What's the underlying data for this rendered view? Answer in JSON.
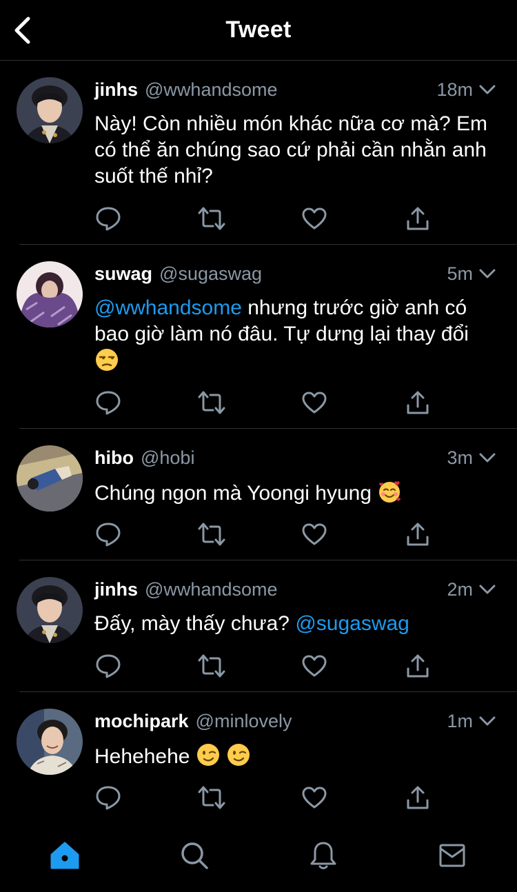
{
  "header": {
    "title": "Tweet"
  },
  "colors": {
    "background": "#000000",
    "text": "#ffffff",
    "muted": "#8b98a5",
    "accent": "#1d9bf0",
    "divider": "#2f3336"
  },
  "tweets": [
    {
      "name": "jinhs",
      "handle": "@wwhandsome",
      "time": "18m",
      "text": "Này! Còn nhiều món khác nữa cơ mà? Em có thể ăn chúng sao cứ phải cần nhằn anh suốt thế nhỉ?",
      "avatar": "avatar-jinhs"
    },
    {
      "name": "suwag",
      "handle": "@sugaswag",
      "time": "5m",
      "mention": "@wwhandsome",
      "text": " nhưng trước giờ anh có bao giờ làm nó đâu. Tự dưng lại thay đổi ",
      "emojis": [
        "unamused-face-emoji"
      ],
      "avatar": "avatar-suwag"
    },
    {
      "name": "hibo",
      "handle": "@hobi",
      "time": "3m",
      "text": "Chúng ngon mà Yoongi hyung ",
      "emojis": [
        "smiling-face-with-hearts-emoji"
      ],
      "avatar": "avatar-hibo"
    },
    {
      "name": "jinhs",
      "handle": "@wwhandsome",
      "time": "2m",
      "text": "Đấy, mày thấy chưa? ",
      "mention": "@sugaswag",
      "avatar": "avatar-jinhs"
    },
    {
      "name": "mochipark",
      "handle": "@minlovely",
      "time": "1m",
      "text": "Hehehehe ",
      "emojis": [
        "winking-face-emoji",
        "winking-face-emoji"
      ],
      "avatar": "avatar-mochipark"
    }
  ],
  "actions": [
    "reply-icon",
    "retweet-icon",
    "like-icon",
    "share-icon"
  ],
  "bottom_nav": [
    "home-icon",
    "search-icon",
    "notifications-icon",
    "messages-icon"
  ]
}
